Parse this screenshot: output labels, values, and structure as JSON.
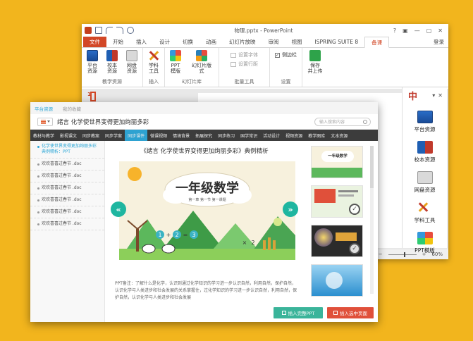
{
  "ppt": {
    "title": "物理.pptx - PowerPoint",
    "window_controls": [
      "?",
      "▣",
      "—",
      "▢",
      "✕"
    ],
    "tabs": [
      "文件",
      "开始",
      "插入",
      "设计",
      "切换",
      "动画",
      "幻灯片放映",
      "审阅",
      "视图",
      "ISPRING SUITE 8",
      "备课"
    ],
    "signin": "登录",
    "groups": {
      "teaching_resources": {
        "name": "教学资源",
        "buttons": [
          "平台\n资源",
          "校本\n资源",
          "网盘\n资源"
        ]
      },
      "insert": {
        "name": "插入",
        "buttons": [
          "学科\n工具"
        ]
      },
      "slide_library": {
        "name": "幻灯片库",
        "buttons": [
          "PPT\n模版",
          "幻灯片版\n式"
        ]
      },
      "batch_tools": {
        "name": "批量工具",
        "rows": [
          "设置字体",
          "设置行距"
        ]
      },
      "settings": {
        "name": "设置",
        "checkbox_label": "侧边栏",
        "checkbox_mark": "✓"
      },
      "save": {
        "button": "保存\n并上传"
      }
    },
    "slide_number": "1",
    "zoom": "60%",
    "zoom_minus": "−",
    "zoom_plus": "+"
  },
  "pane": {
    "logo": "中",
    "controls": [
      "▾",
      "✕"
    ],
    "items": [
      "平台资源",
      "校本资源",
      "网盘资源",
      "学科工具",
      "PPT模版"
    ]
  },
  "dialog": {
    "tabs": [
      "平台资源",
      "我的收藏"
    ],
    "doc_title": "绪言 化学使世界变得更加绚丽多彩",
    "search_placeholder": "输入搜索内容",
    "nav": [
      "教材与教学",
      "影视课文",
      "同步教案",
      "同步学案",
      "同步课件",
      "微课视频",
      "情境背景",
      "拓展探究",
      "同步练习",
      "国学常识",
      "活动设计",
      "视频资源",
      "教学图库",
      "文本资源"
    ],
    "nav_active": 4,
    "list": [
      "化学使世界变得更加绚丽多彩典例精析：PPT",
      "欢欢喜喜过春节 .doc",
      "欢欢喜喜过春节 .doc",
      "欢欢喜喜过春节 .doc",
      "欢欢喜喜过春节 .doc",
      "欢欢喜喜过春节 .doc",
      "欢欢喜喜过春节 .doc"
    ],
    "preview_title": "《绪言 化学使世界变得更加绚丽多彩》典例精析",
    "slide": {
      "heading": "一年级数学",
      "subheading": "第一章 第一节 第一课题",
      "equation_symbols": [
        "1",
        "+",
        "2",
        "=",
        "3",
        "×",
        "2"
      ]
    },
    "note": "PPT备注：了解什么是化学，认识到通过化学知识的学习进一步认识自然，利用自然，保护自然，认识化学与人类进步和社会发展的关系掌握住，过化学知识的学习进一步认识自然，利用自然，保护自然，认识化学与人类进步和社会发展",
    "thumbs": [
      {
        "label": "一年级数学",
        "checked": false
      },
      {
        "label": "",
        "checked": true
      },
      {
        "label": "",
        "checked": true
      },
      {
        "label": "",
        "checked": false
      }
    ],
    "check_mark": "✓",
    "buttons": {
      "insert_all": "插入完整PPT",
      "insert_selected": "插入选中页面"
    },
    "arrows": {
      "prev": "«",
      "next": "»"
    }
  },
  "colors": {
    "background": "#f2b51d",
    "ppt_accent": "#d24726",
    "dialog_accent": "#2ea2d1",
    "btn_green": "#3ab49a",
    "btn_red": "#e0503a"
  }
}
